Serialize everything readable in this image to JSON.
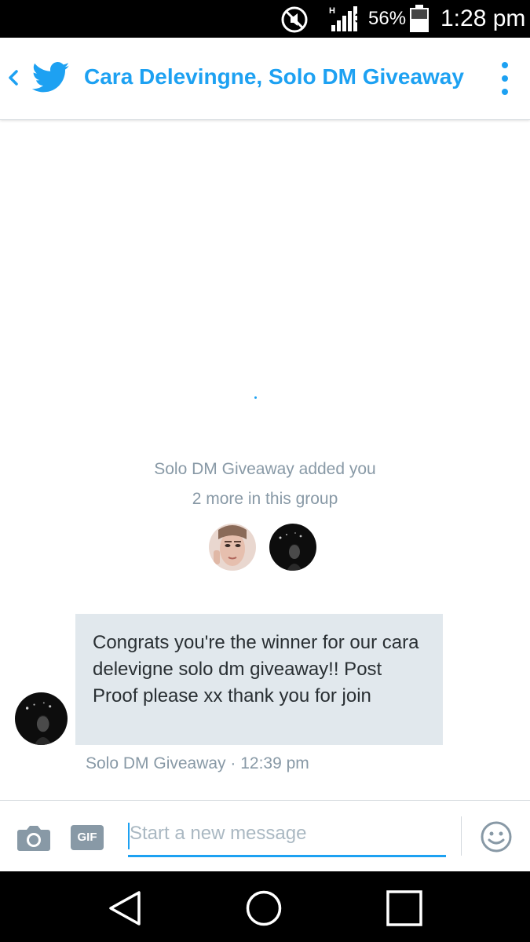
{
  "status_bar": {
    "network_type": "H",
    "battery_percent": "56%",
    "time": "1:28 pm",
    "icons": [
      "mute-icon",
      "signal-icon",
      "battery-icon"
    ]
  },
  "header": {
    "title": "Cara Delevingne, Solo DM Giveaway",
    "icons": [
      "back-chevron-icon",
      "twitter-bird-icon",
      "more-vertical-icon"
    ],
    "accent_color": "#1da1f2"
  },
  "conversation": {
    "system_message": "Solo DM Giveaway added you",
    "group_info": "2 more in this group",
    "messages": [
      {
        "text": "Congrats you're the winner for our cara delevigne solo dm giveaway!! Post Proof please xx thank you for join",
        "sender": "Solo DM Giveaway",
        "time": "12:39 pm",
        "meta": "Solo DM Giveaway · 12:39 pm"
      }
    ]
  },
  "composer": {
    "placeholder": "Start a new message",
    "gif_label": "GIF",
    "icons": [
      "camera-icon",
      "gif-icon",
      "emoji-icon"
    ]
  },
  "nav_bar": {
    "icons": [
      "nav-back-icon",
      "nav-home-icon",
      "nav-recents-icon"
    ]
  }
}
